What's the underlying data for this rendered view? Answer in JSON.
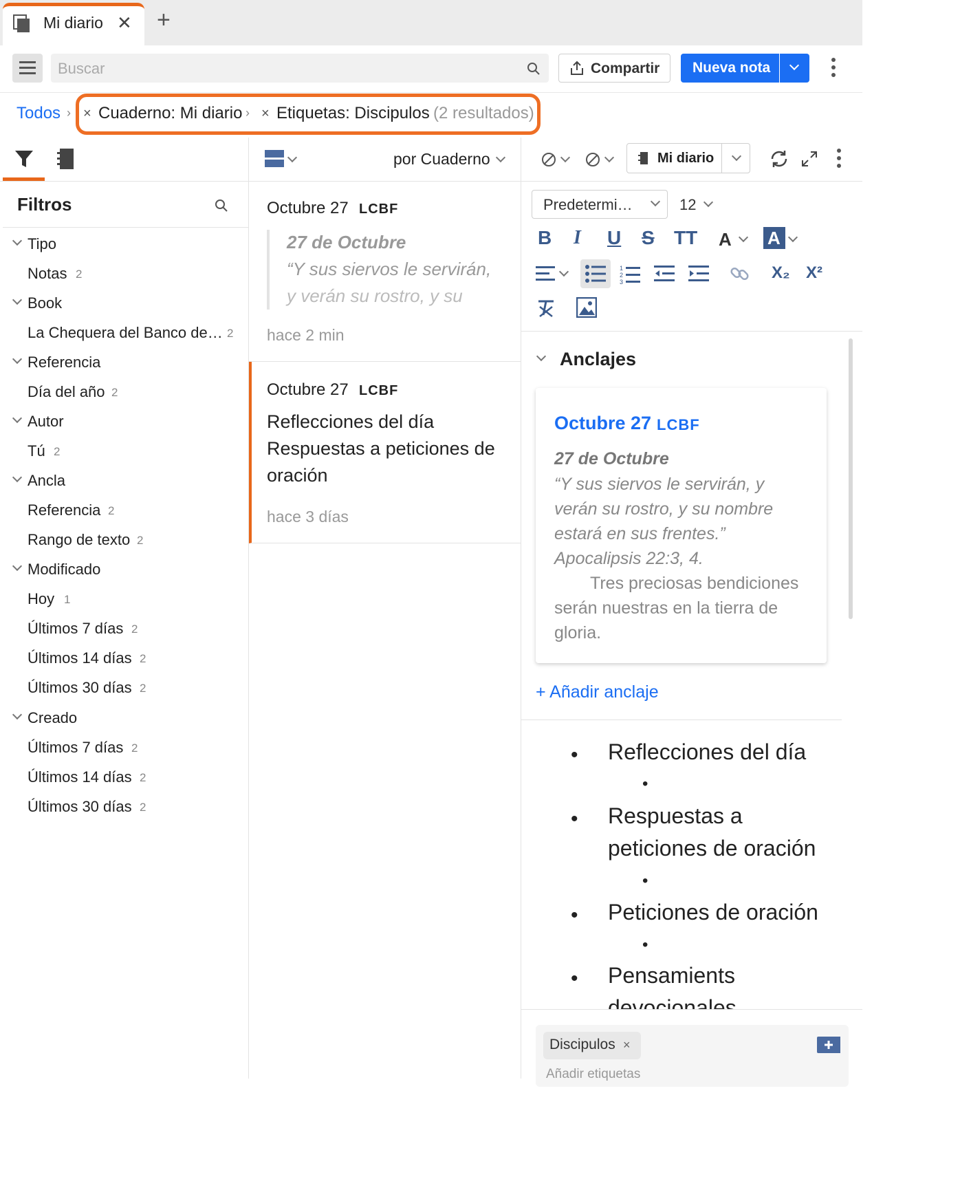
{
  "tab": {
    "title": "Mi diario",
    "close": "✕",
    "add": "+"
  },
  "toolbar": {
    "search_placeholder": "Buscar",
    "share_label": "Compartir",
    "new_note_label": "Nueva nota"
  },
  "breadcrumb": {
    "root": "Todos",
    "sep": "›",
    "chip_x": "×",
    "chip1": "Cuaderno: Mi diario",
    "chip2": "Etiquetas: Discipulos",
    "count": "(2 resultados)"
  },
  "filters": {
    "title": "Filtros",
    "groups": [
      {
        "label": "Tipo"
      },
      {
        "label": "Book"
      },
      {
        "label": "Referencia"
      },
      {
        "label": "Autor"
      },
      {
        "label": "Ancla"
      },
      {
        "label": "Modificado"
      },
      {
        "label": "Creado"
      }
    ],
    "items": [
      {
        "label": "Notas",
        "count": "2"
      },
      {
        "label": "La Chequera del Banco de…",
        "count": "2"
      },
      {
        "label": "Día del año",
        "count": "2"
      },
      {
        "label": "Tú",
        "count": "2"
      },
      {
        "label": "Referencia",
        "count": "2"
      },
      {
        "label": "Rango de texto",
        "count": "2"
      },
      {
        "label": "Hoy",
        "count": "1"
      },
      {
        "label": "Últimos 7 días",
        "count": "2"
      },
      {
        "label": "Últimos 14 días",
        "count": "2"
      },
      {
        "label": "Últimos 30 días",
        "count": "2"
      },
      {
        "label": "Últimos 7 días",
        "count": "2"
      },
      {
        "label": "Últimos 14 días",
        "count": "2"
      },
      {
        "label": "Últimos 30 días",
        "count": "2"
      }
    ]
  },
  "list": {
    "sort_label": "por Cuaderno",
    "notes": [
      {
        "title": "Octubre 27",
        "tag": "LCBF",
        "quote_title": "27 de Octubre",
        "quote_line1": "“Y sus siervos le servirán,",
        "quote_line2": "y verán su rostro, y su",
        "ago": "hace 2 min"
      },
      {
        "title": "Octubre 27",
        "tag": "LCBF",
        "body_line1": "Reflecciones del día",
        "body_line2": "Respuestas a peticiones de",
        "body_line3": "oración",
        "ago": "hace 3 días"
      }
    ]
  },
  "editor": {
    "notebook_label": "Mi diario",
    "font_label": "Predetermi…",
    "size_label": "12",
    "anchors_title": "Anclajes",
    "anchor": {
      "title": "Octubre 27",
      "tag": "LCBF",
      "heading": "27 de Octubre",
      "lines": [
        "“Y sus siervos le servirán, y",
        "verán su rostro, y su nombre",
        "estará en sus frentes.”",
        "Apocalipsis 22:3, 4."
      ],
      "body": [
        "Tres preciosas bendiciones",
        "serán nuestras en la tierra de",
        "gloria."
      ]
    },
    "add_anchor": "+ Añadir anclaje",
    "bullets": [
      "Reflecciones del día",
      "Respuestas a",
      "peticiones de oración",
      "Peticiones de oración",
      "Pensamients",
      "devocionales"
    ],
    "tag_chip": "Discipulos",
    "tag_chip_x": "×",
    "add_tags_placeholder": "Añadir etiquetas"
  }
}
